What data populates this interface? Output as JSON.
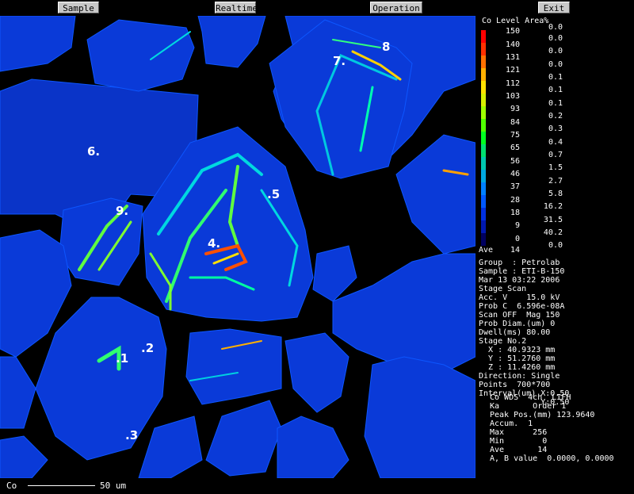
{
  "toolbar": {
    "sample": "Sample",
    "realtime": "Realtime",
    "operation": "Operation",
    "exit": "Exit"
  },
  "element": "Co",
  "scalebar_label": "50 um",
  "points": [
    ".1",
    ".2",
    ".3",
    "4.",
    ".5",
    "6.",
    "7.",
    "8",
    "9."
  ],
  "colorscale": {
    "header": "Co Level Area%",
    "levels": [
      "150",
      "140",
      "131",
      "121",
      "112",
      "103",
      "93",
      "84",
      "75",
      "65",
      "56",
      "46",
      "37",
      "28",
      "18",
      "9",
      "0"
    ],
    "area": [
      "0.0",
      "0.0",
      "0.0",
      "0.0",
      "0.1",
      "0.1",
      "0.1",
      "0.2",
      "0.3",
      "0.4",
      "0.7",
      "1.5",
      "2.7",
      "5.8",
      "16.2",
      "31.5",
      "40.2",
      "0.0"
    ],
    "ave_label": "Ave",
    "ave_value": "14",
    "colors": [
      "#ff0000",
      "#ff3000",
      "#ff7000",
      "#ffb000",
      "#ffe000",
      "#d8f000",
      "#a0ff00",
      "#50ff00",
      "#00ff20",
      "#00e070",
      "#00c8b0",
      "#00a8e0",
      "#0080ff",
      "#0058ff",
      "#0030e0",
      "#0018b0",
      "#000060"
    ]
  },
  "info": {
    "lines": [
      "Group  : Petrolab",
      "Sample : ETI-B-150",
      "Mar 13 03:22 2006",
      "Stage Scan",
      "Acc. V    15.0 kV",
      "Prob C  6.596e-08A",
      "Scan OFF  Mag 150",
      "Prob Diam.(um) 0",
      "Dwell(ms) 80.00",
      "Stage No.2",
      "  X : 40.9323 mm",
      "  Y : 51.2760 mm",
      "  Z : 11.4260 mm",
      "Direction: Single",
      "Points  700*700",
      "Interval(um) X:0.50",
      "             Y:0.50"
    ],
    "spec_lines": [
      "Co WDS  4ch  LIFH",
      "Ka       Order 1",
      "Peak Pos.(mm) 123.9640",
      "Accum.  1",
      "Max      256",
      "Min        0",
      "Ave       14",
      "A, B value  0.0000, 0.0000"
    ]
  }
}
